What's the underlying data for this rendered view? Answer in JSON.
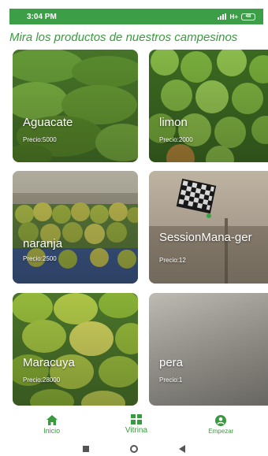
{
  "status": {
    "time": "3:04 PM",
    "network": "H+",
    "battery": "48"
  },
  "headline": "Mira los productos de nuestros campesinos",
  "products": [
    {
      "name": "Aguacate",
      "price": "Precio:5000"
    },
    {
      "name": "limon",
      "price": "Precio:2000"
    },
    {
      "name": "naranja",
      "price": "Precio:2500"
    },
    {
      "name": "SessionMana-ger",
      "price": "Precio:12"
    },
    {
      "name": "Maracuya",
      "price": "Precio:28000"
    },
    {
      "name": "pera",
      "price": "Precio:1"
    }
  ],
  "nav": [
    {
      "label": "Inicio",
      "icon": "home-icon"
    },
    {
      "label": "Vitrina",
      "icon": "grid-icon"
    },
    {
      "label": "Empezar",
      "icon": "account-icon"
    }
  ],
  "colors": {
    "status_bar": "#3d9e48",
    "accent": "#3a9a3f"
  }
}
